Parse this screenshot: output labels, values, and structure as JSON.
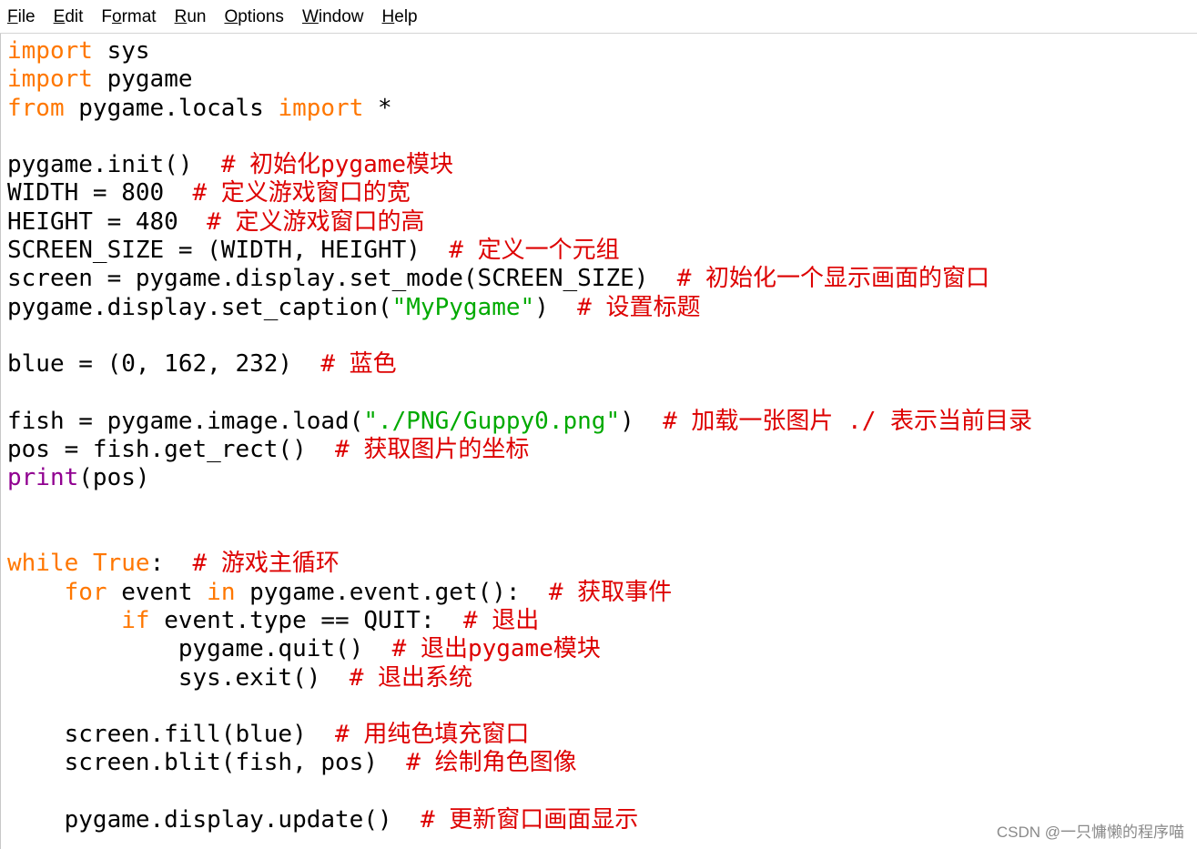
{
  "menubar": {
    "items": [
      {
        "mnemonic": "F",
        "rest": "ile"
      },
      {
        "mnemonic": "E",
        "rest": "dit"
      },
      {
        "pre": "F",
        "mnemonic": "o",
        "rest": "rmat"
      },
      {
        "mnemonic": "R",
        "rest": "un"
      },
      {
        "mnemonic": "O",
        "rest": "ptions"
      },
      {
        "mnemonic": "W",
        "rest": "indow"
      },
      {
        "mnemonic": "H",
        "rest": "elp"
      }
    ]
  },
  "colors": {
    "keyword": "#ff7700",
    "builtin": "#900090",
    "string": "#00aa00",
    "comment": "#dd0000",
    "text": "#000000"
  },
  "editor": {
    "lines": [
      [
        {
          "t": "kw",
          "v": "import"
        },
        {
          "t": "tx",
          "v": " sys"
        }
      ],
      [
        {
          "t": "kw",
          "v": "import"
        },
        {
          "t": "tx",
          "v": " pygame"
        }
      ],
      [
        {
          "t": "kw",
          "v": "from"
        },
        {
          "t": "tx",
          "v": " pygame.locals "
        },
        {
          "t": "kw",
          "v": "import"
        },
        {
          "t": "tx",
          "v": " *"
        }
      ],
      [],
      [
        {
          "t": "tx",
          "v": "pygame.init()  "
        },
        {
          "t": "cm",
          "v": "# 初始化pygame模块"
        }
      ],
      [
        {
          "t": "tx",
          "v": "WIDTH = 800  "
        },
        {
          "t": "cm",
          "v": "# 定义游戏窗口的宽"
        }
      ],
      [
        {
          "t": "tx",
          "v": "HEIGHT = 480  "
        },
        {
          "t": "cm",
          "v": "# 定义游戏窗口的高"
        }
      ],
      [
        {
          "t": "tx",
          "v": "SCREEN_SIZE = (WIDTH, HEIGHT)  "
        },
        {
          "t": "cm",
          "v": "# 定义一个元组"
        }
      ],
      [
        {
          "t": "tx",
          "v": "screen = pygame.display.set_mode(SCREEN_SIZE)  "
        },
        {
          "t": "cm",
          "v": "# 初始化一个显示画面的窗口"
        }
      ],
      [
        {
          "t": "tx",
          "v": "pygame.display.set_caption("
        },
        {
          "t": "st",
          "v": "\"MyPygame\""
        },
        {
          "t": "tx",
          "v": ")  "
        },
        {
          "t": "cm",
          "v": "# 设置标题"
        }
      ],
      [],
      [
        {
          "t": "tx",
          "v": "blue = (0, 162, 232)  "
        },
        {
          "t": "cm",
          "v": "# 蓝色"
        }
      ],
      [],
      [
        {
          "t": "tx",
          "v": "fish = pygame.image.load("
        },
        {
          "t": "st",
          "v": "\"./PNG/Guppy0.png\""
        },
        {
          "t": "tx",
          "v": ")  "
        },
        {
          "t": "cm",
          "v": "# 加载一张图片 ./ 表示当前目录"
        }
      ],
      [
        {
          "t": "tx",
          "v": "pos = fish.get_rect()  "
        },
        {
          "t": "cm",
          "v": "# 获取图片的坐标"
        }
      ],
      [
        {
          "t": "bi",
          "v": "print"
        },
        {
          "t": "tx",
          "v": "(pos)"
        }
      ],
      [],
      [],
      [
        {
          "t": "kw",
          "v": "while"
        },
        {
          "t": "tx",
          "v": " "
        },
        {
          "t": "kw",
          "v": "True"
        },
        {
          "t": "tx",
          "v": ":  "
        },
        {
          "t": "cm",
          "v": "# 游戏主循环"
        }
      ],
      [
        {
          "t": "tx",
          "v": "    "
        },
        {
          "t": "kw",
          "v": "for"
        },
        {
          "t": "tx",
          "v": " event "
        },
        {
          "t": "kw",
          "v": "in"
        },
        {
          "t": "tx",
          "v": " pygame.event.get():  "
        },
        {
          "t": "cm",
          "v": "# 获取事件"
        }
      ],
      [
        {
          "t": "tx",
          "v": "        "
        },
        {
          "t": "kw",
          "v": "if"
        },
        {
          "t": "tx",
          "v": " event.type == QUIT:  "
        },
        {
          "t": "cm",
          "v": "# 退出"
        }
      ],
      [
        {
          "t": "tx",
          "v": "            pygame.quit()  "
        },
        {
          "t": "cm",
          "v": "# 退出pygame模块"
        }
      ],
      [
        {
          "t": "tx",
          "v": "            sys.exit()  "
        },
        {
          "t": "cm",
          "v": "# 退出系统"
        }
      ],
      [],
      [
        {
          "t": "tx",
          "v": "    screen.fill(blue)  "
        },
        {
          "t": "cm",
          "v": "# 用纯色填充窗口"
        }
      ],
      [
        {
          "t": "tx",
          "v": "    screen.blit(fish, pos)  "
        },
        {
          "t": "cm",
          "v": "# 绘制角色图像"
        }
      ],
      [],
      [
        {
          "t": "tx",
          "v": "    pygame.display.update()  "
        },
        {
          "t": "cm",
          "v": "# 更新窗口画面显示"
        }
      ]
    ]
  },
  "watermark": "CSDN @一只慵懒的程序喵"
}
